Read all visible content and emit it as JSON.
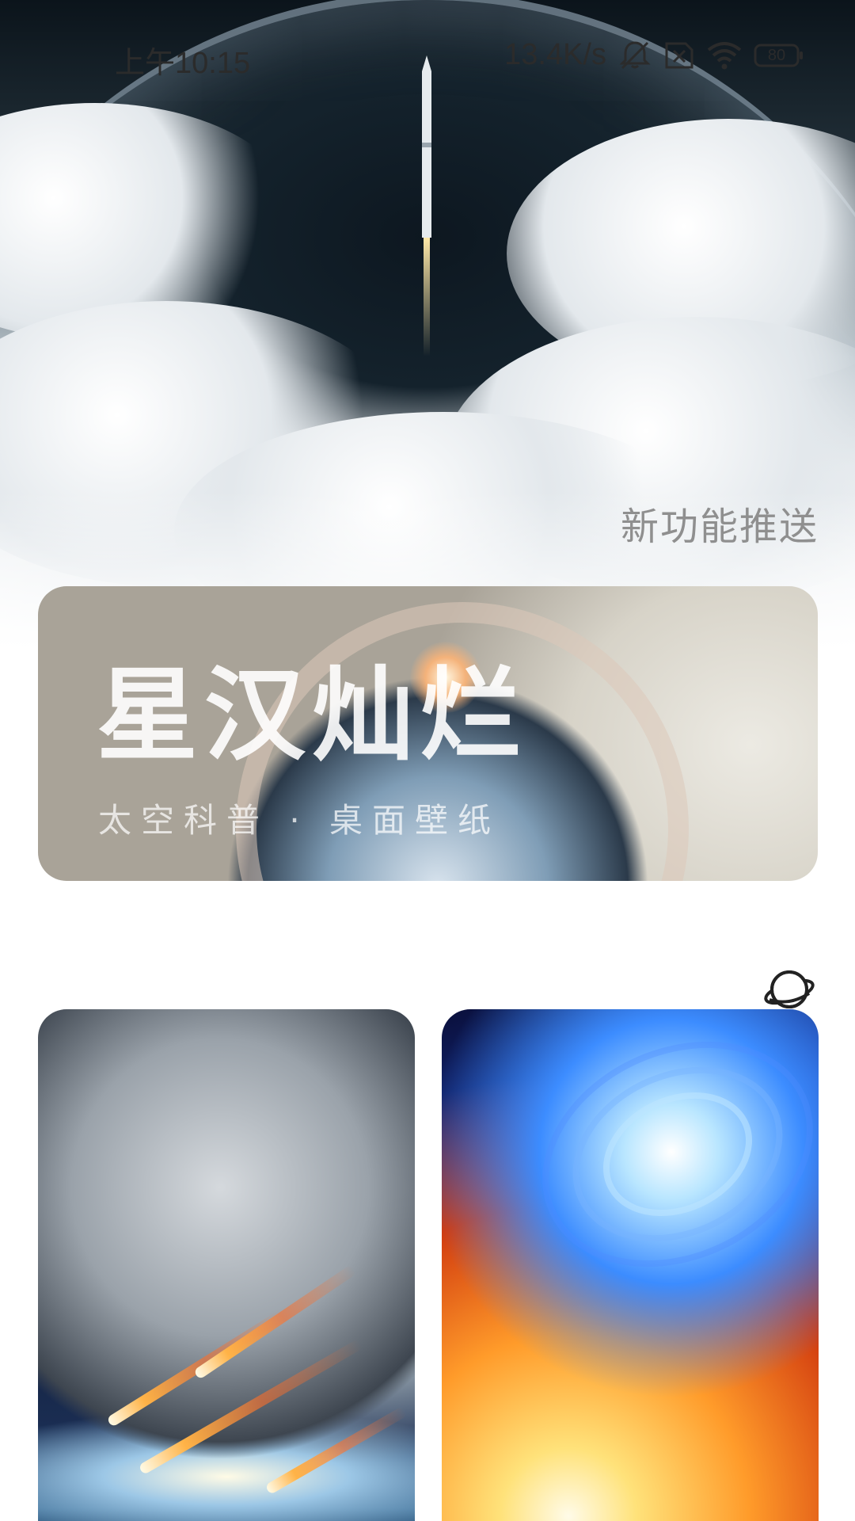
{
  "status_bar": {
    "time": "上午10:15",
    "network_speed": "13.4K/s",
    "battery": "80",
    "icons": [
      "mute-icon",
      "sim-off-icon",
      "wifi-icon",
      "battery-icon"
    ]
  },
  "hero": {
    "image": "rocket-launch-through-clouds",
    "promo_label": "新功能推送"
  },
  "banner": {
    "title": "星汉灿烂",
    "subtitle": "太空科普 · 桌面壁纸",
    "image": "astronaut-spacewalk-over-earth"
  },
  "planet_button": {
    "icon": "planet-icon"
  },
  "grid": {
    "items": [
      {
        "image": "moons-and-meteors-over-ocean"
      },
      {
        "image": "blue-galaxy-and-fiery-explosion"
      }
    ]
  },
  "colors": {
    "background": "#ffffff",
    "promo_label": "#8f8f8f",
    "status_text": "#2b2b2b"
  }
}
